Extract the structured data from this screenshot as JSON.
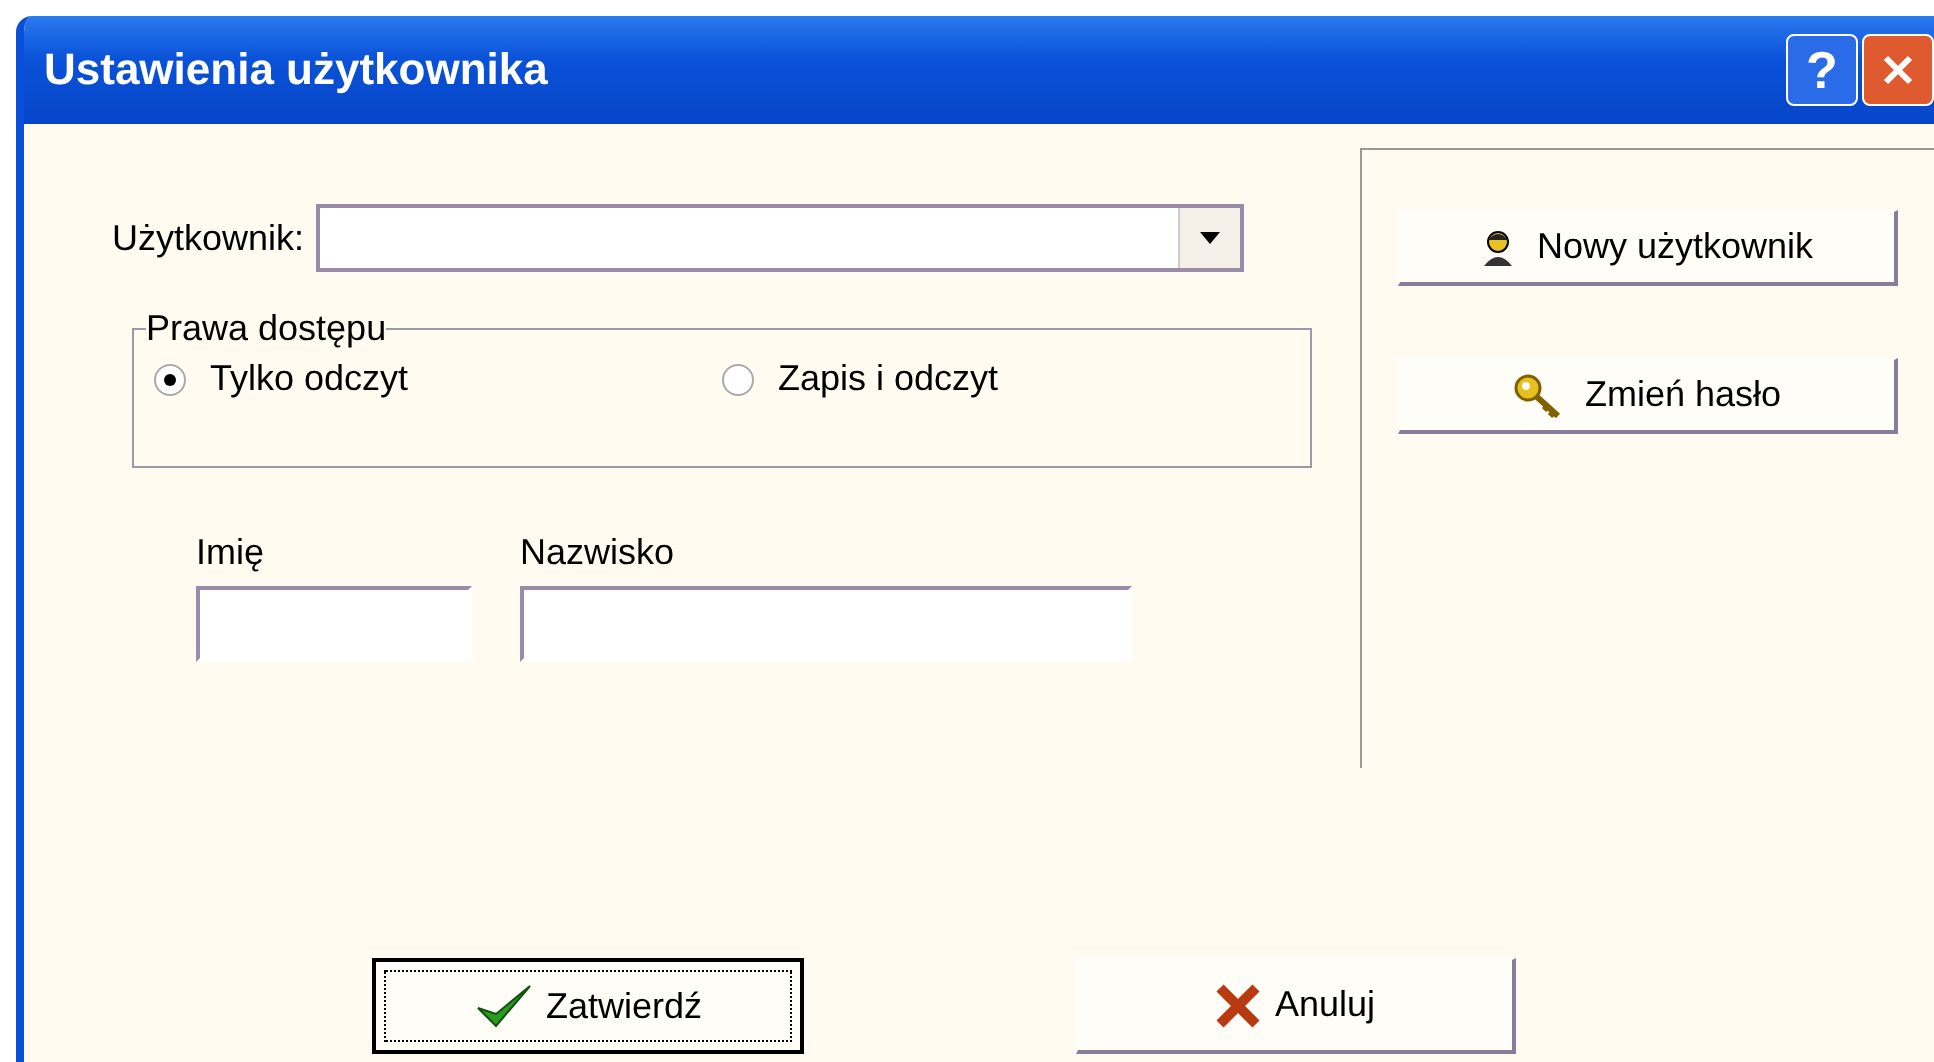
{
  "window": {
    "title": "Ustawienia użytkownika",
    "title_buttons": [
      {
        "kind": "help",
        "label": "?"
      },
      {
        "kind": "close"
      }
    ]
  },
  "user_field": {
    "label": "Użytkownik:"
  },
  "access_group": {
    "label": "Prawa dostępu",
    "options": [
      {
        "label": "Tylko odczyt",
        "selected": true
      },
      {
        "label": "Zapis i odczyt",
        "selected": false
      }
    ]
  },
  "name_fields": [
    {
      "label": "Imię",
      "kind": "short"
    },
    {
      "label": "Nazwisko",
      "kind": "long"
    }
  ],
  "side_buttons": [
    {
      "label": "Nowy użytkownik",
      "kind": "user"
    },
    {
      "label": "Zmień hasło",
      "kind": "key"
    }
  ],
  "buttons": [
    {
      "label": "Zatwierdź",
      "kind": "ok",
      "default": true
    },
    {
      "label": "Anuluj",
      "kind": "cancel",
      "default": false
    }
  ]
}
